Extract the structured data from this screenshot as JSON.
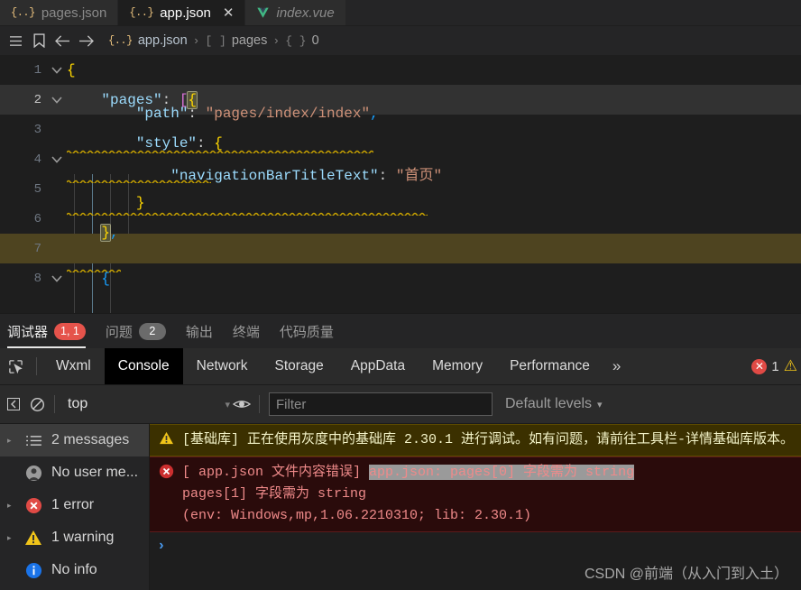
{
  "editor": {
    "tabs": [
      {
        "label": "pages.json",
        "icon": "json-icon",
        "active": false,
        "italic": false,
        "closable": false
      },
      {
        "label": "app.json",
        "icon": "json-icon",
        "active": true,
        "italic": false,
        "closable": true
      },
      {
        "label": "index.vue",
        "icon": "vue-icon",
        "active": false,
        "italic": true,
        "closable": false
      }
    ],
    "close_glyph": "✕",
    "breadcrumb": {
      "menu_icon": "hamburger-menu-icon",
      "bookmark_icon": "bookmark-icon",
      "back_icon": "arrow-left-icon",
      "forward_icon": "arrow-right-icon",
      "items": [
        {
          "brace": "{..}",
          "label": "app.json"
        },
        {
          "brace": "[ ]",
          "label": "pages"
        },
        {
          "brace": "{ }",
          "label": "0"
        }
      ],
      "separator": "›"
    },
    "lines": [
      {
        "num": "1",
        "fold": "v",
        "text": "{"
      },
      {
        "num": "2",
        "fold": "v",
        "text": "    \"pages\": [{"
      },
      {
        "num": "3",
        "fold": "",
        "text": "        \"path\": \"pages/index/index\","
      },
      {
        "num": "4",
        "fold": "v",
        "text": "        \"style\": {"
      },
      {
        "num": "5",
        "fold": "",
        "text": "            \"navigationBarTitleText\": \"首页\""
      },
      {
        "num": "6",
        "fold": "",
        "text": "        }"
      },
      {
        "num": "7",
        "fold": "",
        "text": "    },"
      },
      {
        "num": "8",
        "fold": "v",
        "text": "    {"
      }
    ]
  },
  "panel": {
    "tabs": [
      {
        "label": "调试器",
        "badge": "1, 1",
        "badge_style": "red",
        "active": true
      },
      {
        "label": "问题",
        "badge": "2",
        "badge_style": "grey",
        "active": false
      },
      {
        "label": "输出",
        "badge": "",
        "badge_style": "",
        "active": false
      },
      {
        "label": "终端",
        "badge": "",
        "badge_style": "",
        "active": false
      },
      {
        "label": "代码质量",
        "badge": "",
        "badge_style": "",
        "active": false
      }
    ]
  },
  "devtools": {
    "inspect_icon": "inspect-element-icon",
    "tabs": [
      {
        "label": "Wxml",
        "active": false
      },
      {
        "label": "Console",
        "active": true
      },
      {
        "label": "Network",
        "active": false
      },
      {
        "label": "Storage",
        "active": false
      },
      {
        "label": "AppData",
        "active": false
      },
      {
        "label": "Memory",
        "active": false
      },
      {
        "label": "Performance",
        "active": false
      }
    ],
    "more_glyph": "»",
    "error_count": "1",
    "error_icon": "error-circle-icon",
    "warning_icon": "warning-triangle-icon"
  },
  "console_toolbar": {
    "sidebar_toggle_icon": "panel-toggle-icon",
    "clear_icon": "clear-console-icon",
    "context": "top",
    "context_caret": "▾",
    "eye_icon": "live-expression-icon",
    "filter_placeholder": "Filter",
    "filter_value": "",
    "levels_label": "Default levels",
    "levels_caret": "▾"
  },
  "console_sidebar": {
    "items": [
      {
        "label": "2 messages",
        "icon": "list-icon",
        "selected": true,
        "expandable": true
      },
      {
        "label": "No user me...",
        "icon": "user-icon",
        "selected": false,
        "expandable": false
      },
      {
        "label": "1 error",
        "icon": "error-circle-icon",
        "selected": false,
        "expandable": true
      },
      {
        "label": "1 warning",
        "icon": "warning-triangle-icon",
        "selected": false,
        "expandable": true
      },
      {
        "label": "No info",
        "icon": "info-circle-icon",
        "selected": false,
        "expandable": false
      }
    ]
  },
  "console_messages": {
    "warning": {
      "icon": "warning-triangle-icon",
      "text": "[基础库] 正在使用灰度中的基础库 2.30.1 进行调试。如有问题，请前往工具栏-详情基础库版本。"
    },
    "error": {
      "icon": "error-circle-icon",
      "prefix": "[ app.json 文件内容错误] ",
      "highlighted": "app.json: pages[0] 字段需为 string",
      "rest": "\npages[1] 字段需为 string\n(env: Windows,mp,1.06.2210310; lib: 2.30.1)"
    },
    "prompt_glyph": "›"
  },
  "watermark": "CSDN @前端（从入门到入土）",
  "colors": {
    "editor_bg": "#1e1e1e",
    "tab_bg": "#2d2d2d",
    "accent_error": "#e5534b",
    "accent_warning": "#f0c419",
    "key_blue": "#9cdcfe",
    "string_orange": "#ce9178"
  }
}
